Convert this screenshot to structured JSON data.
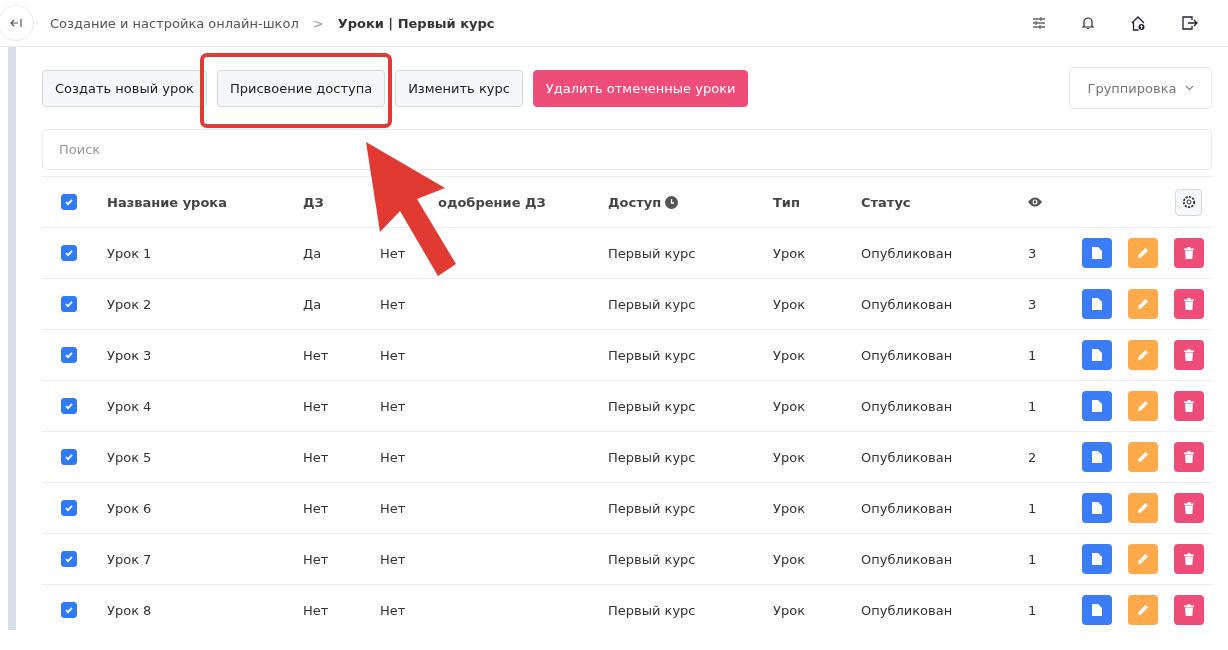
{
  "breadcrumb": {
    "parent": "Создание и настройка онлайн-школ",
    "separator": ">",
    "current": "Уроки | Первый курс"
  },
  "toolbar": {
    "buttons": [
      {
        "label": "Создать новый урок",
        "kind": "default"
      },
      {
        "label": "Присвоение доступа",
        "kind": "default"
      },
      {
        "label": "Изменить курс",
        "kind": "default"
      },
      {
        "label": "Удалить отмеченные уроки",
        "kind": "danger"
      }
    ],
    "grouping": "Группировка"
  },
  "search": {
    "placeholder": "Поиск"
  },
  "table": {
    "all_checked": true,
    "columns": [
      "Название урока",
      "ДЗ",
      "одобрение ДЗ",
      "Доступ",
      "Тип",
      "Статус"
    ],
    "rows": [
      {
        "checked": true,
        "cells": [
          "Урок 1",
          "Да",
          "Нет",
          "Первый курс",
          "Урок",
          "Опубликован",
          "3"
        ]
      },
      {
        "checked": true,
        "cells": [
          "Урок 2",
          "Да",
          "Нет",
          "Первый курс",
          "Урок",
          "Опубликован",
          "3"
        ]
      },
      {
        "checked": true,
        "cells": [
          "Урок 3",
          "Нет",
          "Нет",
          "Первый курс",
          "Урок",
          "Опубликован",
          "1"
        ]
      },
      {
        "checked": true,
        "cells": [
          "Урок 4",
          "Нет",
          "Нет",
          "Первый курс",
          "Урок",
          "Опубликован",
          "1"
        ]
      },
      {
        "checked": true,
        "cells": [
          "Урок 5",
          "Нет",
          "Нет",
          "Первый курс",
          "Урок",
          "Опубликован",
          "2"
        ]
      },
      {
        "checked": true,
        "cells": [
          "Урок 6",
          "Нет",
          "Нет",
          "Первый курс",
          "Урок",
          "Опубликован",
          "1"
        ]
      },
      {
        "checked": true,
        "cells": [
          "Урок 7",
          "Нет",
          "Нет",
          "Первый курс",
          "Урок",
          "Опубликован",
          "1"
        ]
      },
      {
        "checked": true,
        "cells": [
          "Урок 8",
          "Нет",
          "Нет",
          "Первый курс",
          "Урок",
          "Опубликован",
          "1"
        ]
      }
    ]
  }
}
